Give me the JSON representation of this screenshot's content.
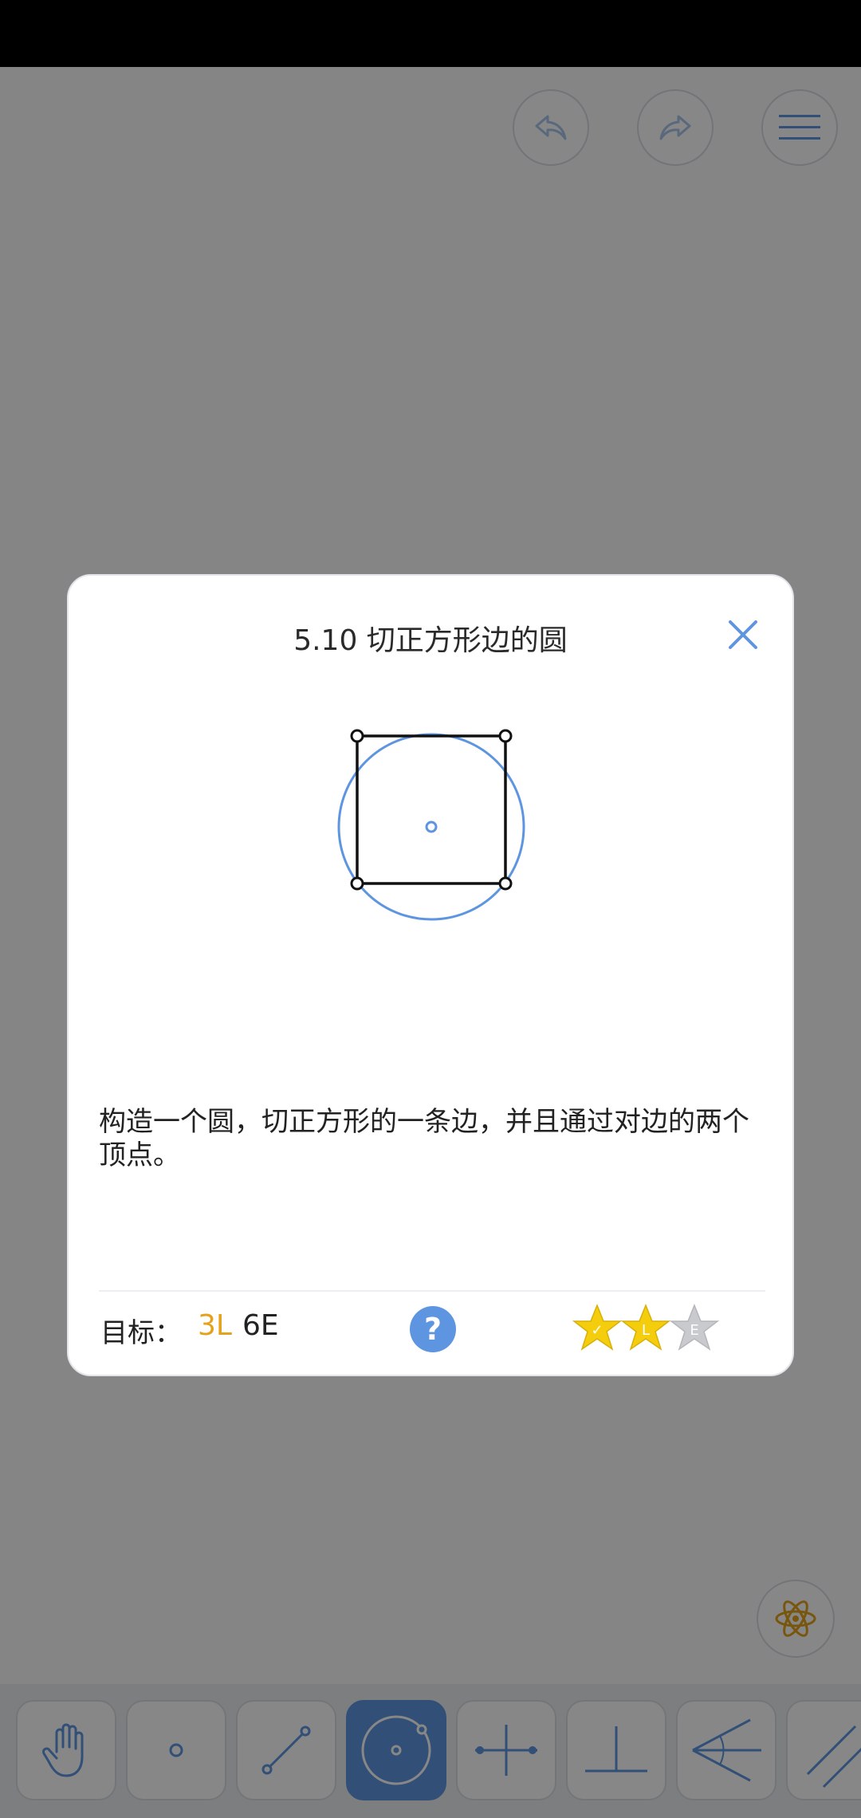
{
  "dialog": {
    "title": "5.10 切正方形边的圆",
    "description": "构造一个圆，切正方形的一条边，并且通过对边的两个顶点。",
    "goal_label": "目标：",
    "goal_l": "3L",
    "goal_e": "6E",
    "help_glyph": "?",
    "stars": [
      {
        "label": "✓",
        "earned": true
      },
      {
        "label": "L",
        "earned": true
      },
      {
        "label": "E",
        "earned": false
      }
    ]
  },
  "colors": {
    "accent": "#5e95e0",
    "goal_l": "#e3a21a",
    "star_gold": "#f4cd0c",
    "star_gray": "#c9cacd"
  },
  "icons": {
    "top": [
      "undo-icon",
      "redo-icon",
      "menu-icon"
    ],
    "tools": [
      "hand-icon",
      "point-icon",
      "line-segment-icon",
      "circle-icon",
      "perpendicular-bisector-icon",
      "perpendicular-icon",
      "angle-bisector-icon",
      "parallel-icon"
    ],
    "fab": "atom-icon"
  }
}
